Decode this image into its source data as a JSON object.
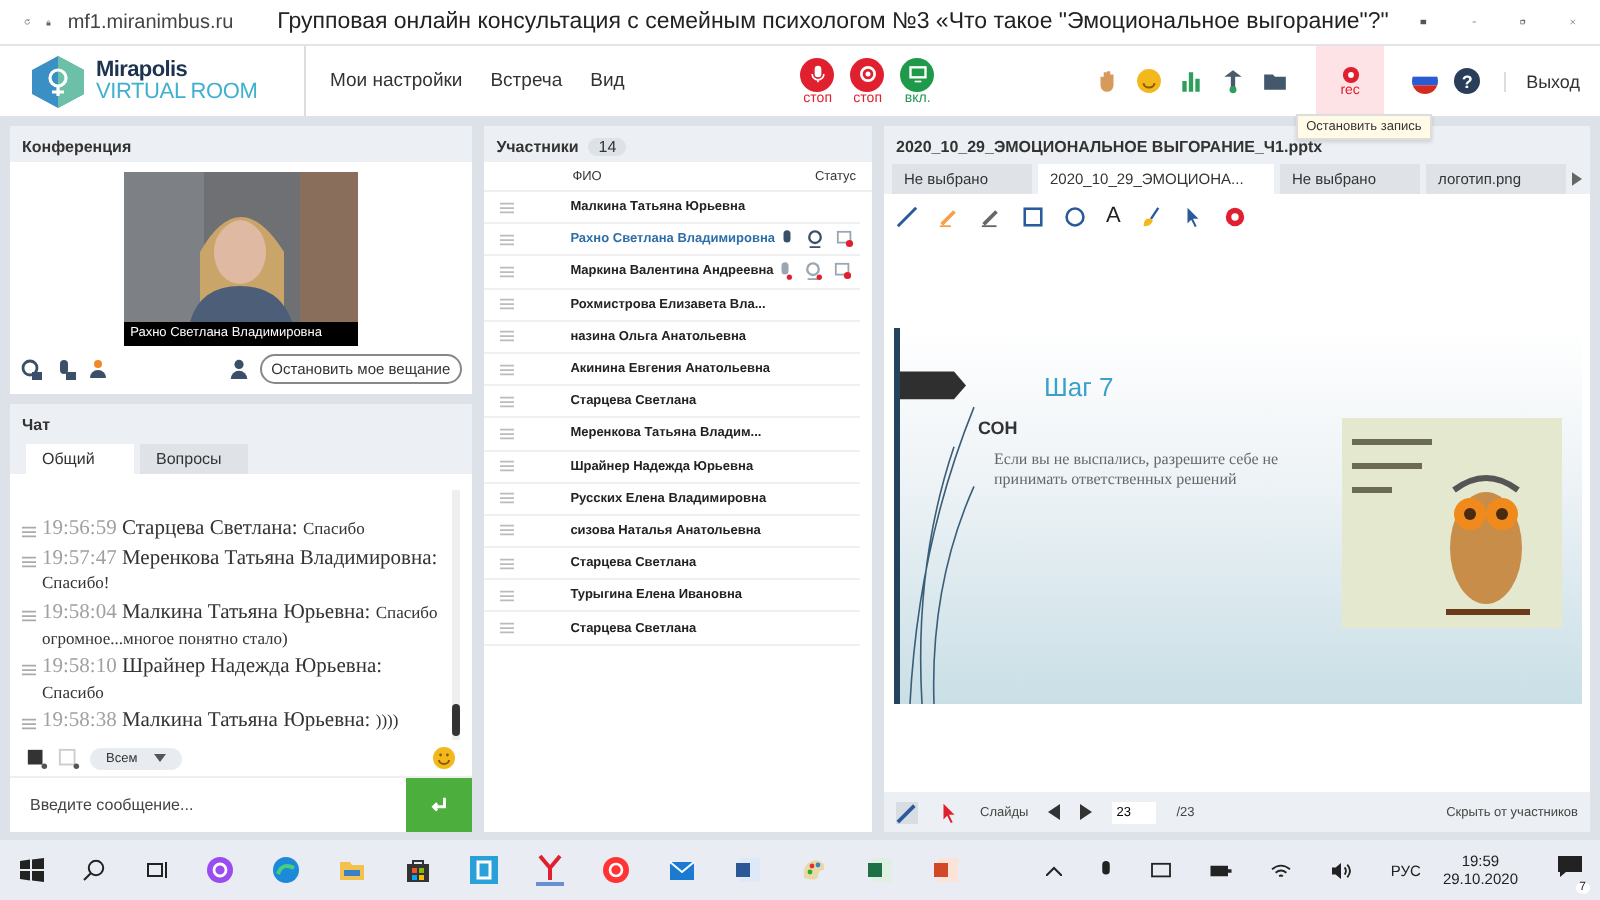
{
  "browser": {
    "url": "mf1.miranimbus.ru",
    "title": "Групповая онлайн консультация с семейным психологом №3 «Что такое \"Эмоциональное выгорание\"?\""
  },
  "header": {
    "logo_top": "Mirapolis",
    "logo_bottom": "VIRTUAL ROOM",
    "menu": [
      "Мои настройки",
      "Встреча",
      "Вид"
    ],
    "media_buttons": [
      {
        "kind": "mic",
        "label": "стоп",
        "on": true
      },
      {
        "kind": "camera",
        "label": "стоп",
        "on": true
      },
      {
        "kind": "screen",
        "label": "вкл.",
        "on": false
      }
    ],
    "rec_label": "rec",
    "rec_tooltip": "Остановить запись",
    "exit": "Выход",
    "help": "?"
  },
  "conference": {
    "title": "Конференция",
    "video_caption": "Рахно Светлана  Владимировна",
    "stop_button": "Остановить мое вещание"
  },
  "chat": {
    "title": "Чат",
    "tabs": [
      {
        "label": "Общий",
        "selected": true
      },
      {
        "label": "Вопросы",
        "selected": false
      }
    ],
    "messages": [
      {
        "time": "19:56:59",
        "author": "Старцева  Светлана:",
        "text": "Спасибо"
      },
      {
        "time": "19:57:47",
        "author": "Меренкова  Татьяна  Владимировна:",
        "text": "Спасибо!"
      },
      {
        "time": "19:58:04",
        "author": "Малкина Татьяна  Юрьевна:",
        "text": "Спасибо огромное...многое понятно стало)"
      },
      {
        "time": "19:58:10",
        "author": "Шрайнер Надежда  Юрьевна:",
        "text": "Спасибо"
      },
      {
        "time": "19:58:38",
        "author": "Малкина Татьяна  Юрьевна:",
        "text": "))))"
      }
    ],
    "recipient": "Всем",
    "input_placeholder": "Введите сообщение..."
  },
  "participants": {
    "title": "Участники",
    "count": "14",
    "columns": [
      "ФИО",
      "Статус"
    ],
    "rows": [
      {
        "name": "Малкина Татьяна  Юрьевна",
        "selected": false
      },
      {
        "name": "Рахно Светлана  Владимировна",
        "selected": true,
        "media": {
          "muted": false
        }
      },
      {
        "name": "Маркина Валентина  Андреевна",
        "selected": false,
        "media": {
          "muted": true
        }
      },
      {
        "name": "Рохмистрова  Елизавета Вла...",
        "selected": false
      },
      {
        "name": "назина  Ольга  Анатольевна",
        "selected": false
      },
      {
        "name": "Акинина  Евгения Анатольевна",
        "selected": false
      },
      {
        "name": "Старцева  Светлана",
        "selected": false
      },
      {
        "name": "Меренкова  Татьяна  Владим...",
        "selected": false
      },
      {
        "name": "Шрайнер Надежда  Юрьевна",
        "selected": false
      },
      {
        "name": "Русских Елена Владимировна",
        "selected": false
      },
      {
        "name": "сизова  Наталья  Анатольевна",
        "selected": false
      },
      {
        "name": "Старцева Светлана",
        "selected": false
      },
      {
        "name": "Турыгина  Елена  Ивановна",
        "selected": false
      },
      {
        "name": "Старцева  Светлана",
        "selected": false
      }
    ]
  },
  "presentation": {
    "title": "2020_10_29_ЭМОЦИОНАЛЬНОЕ ВЫГОРАНИЕ_Ч1.pptx",
    "tabs": [
      {
        "label": "Не выбрано",
        "selected": false
      },
      {
        "label": "2020_10_29_ЭМОЦИОНА...",
        "selected": true
      },
      {
        "label": "Не выбрано",
        "selected": false
      },
      {
        "label": "логотип.png",
        "selected": false
      }
    ],
    "tools": [
      {
        "kind": "pen"
      },
      {
        "kind": "marker"
      },
      {
        "kind": "pencil"
      },
      {
        "kind": "rect"
      },
      {
        "kind": "ellipse"
      },
      {
        "kind": "text",
        "label": "A"
      },
      {
        "kind": "fill"
      },
      {
        "kind": "pointer"
      },
      {
        "kind": "clear"
      }
    ],
    "slide": {
      "heading": "Шаг 7",
      "bullet": "СОН",
      "body": "Если вы не выспались, разрешите себе не принимать ответственных решений"
    },
    "footer": {
      "slides_label": "Слайды",
      "page": "23",
      "total": "/23",
      "hide": "Скрыть от участников"
    }
  },
  "taskbar": {
    "language": "РУС",
    "time": "19:59",
    "date": "29.10.2020",
    "notifications": "7"
  }
}
